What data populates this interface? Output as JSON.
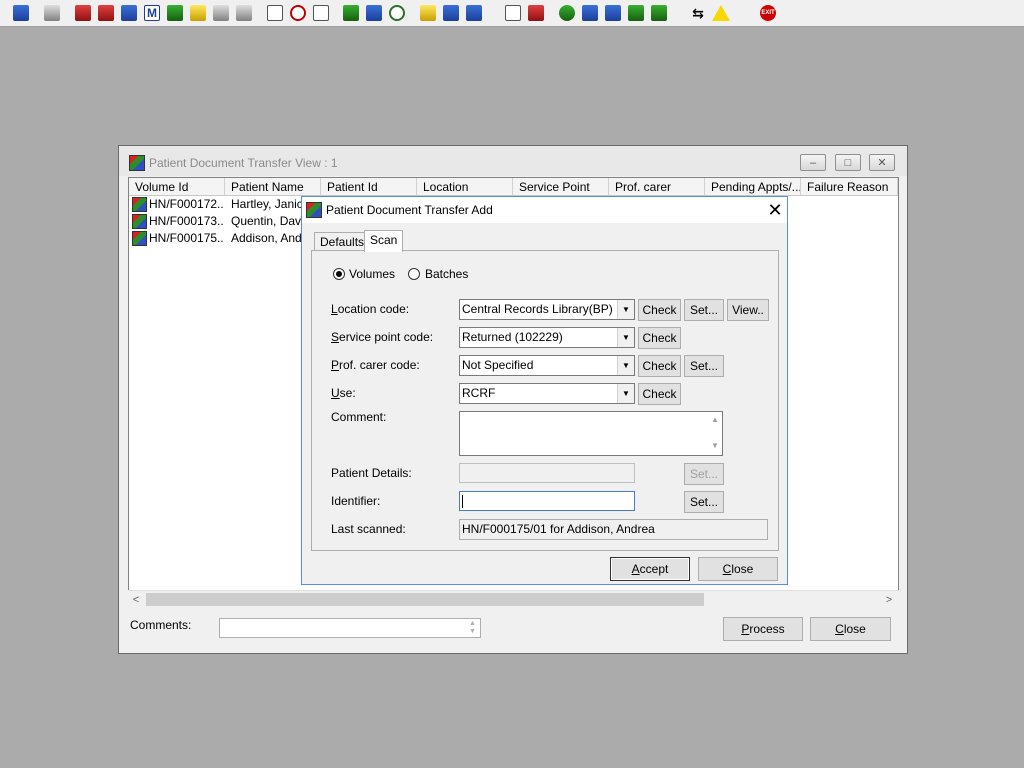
{
  "toolbar": {
    "icons": [
      "user-manage-icon",
      "print-icon",
      "book-red-icon",
      "document-edit-icon",
      "report-icon",
      "m-letter-icon",
      "doctor-icon",
      "notes-icon",
      "ambulance-icon",
      "transfer-icon",
      "mail-icon",
      "clock-icon",
      "window-icon",
      "calendar-icon",
      "form-icon",
      "gauge-icon",
      "notepad-icon",
      "tray-icon",
      "patient-transfer-icon",
      "blank-doc-icon",
      "chart-icon",
      "globe-icon",
      "inbox-down-icon",
      "inbox-check-icon",
      "inbox-green-icon",
      "file-transfer-icon",
      "swap-icon",
      "warning-icon",
      "exit-icon"
    ],
    "exit_label": "EXIT",
    "m_label": "M"
  },
  "main_window": {
    "title": "Patient Document Transfer View : 1",
    "minimize_glyph": "–",
    "restore_glyph": "□",
    "close_glyph": "✕",
    "columns": [
      "Volume Id",
      "Patient Name",
      "Patient Id",
      "Location",
      "Service Point",
      "Prof. carer",
      "Pending Appts/...",
      "Failure Reason"
    ],
    "rows": [
      {
        "volume_id": "HN/F000172...",
        "patient_name": "Hartley, Janice"
      },
      {
        "volume_id": "HN/F000173...",
        "patient_name": "Quentin, David"
      },
      {
        "volume_id": "HN/F000175...",
        "patient_name": "Addison, Andrea"
      }
    ],
    "scroll_left": "<",
    "scroll_right": ">",
    "comments_label": "Comments:",
    "comments_value": "",
    "process_label": "Process",
    "process_accel": "P",
    "close_label": "Close",
    "close_accel": "C"
  },
  "dialog": {
    "title": "Patient Document Transfer Add",
    "close_glyph": "✕",
    "tabs": [
      "Defaults",
      "Scan"
    ],
    "active_tab": "Scan",
    "radio_volumes": "Volumes",
    "radio_batches": "Batches",
    "selected_radio": "Volumes",
    "location_label": "Location code:",
    "location_accel": "L",
    "location_value": "Central Records Library(BP)",
    "service_label": "Service point code:",
    "service_accel": "S",
    "service_value": "Returned (102229)",
    "prof_label": "Prof. carer code:",
    "prof_accel": "P",
    "prof_value": "Not Specified",
    "use_label": "Use:",
    "use_accel": "U",
    "use_value": "RCRF",
    "comment_label": "Comment:",
    "comment_value": "",
    "patient_details_label": "Patient Details:",
    "patient_details_value": "",
    "identifier_label": "Identifier:",
    "identifier_value": "",
    "last_scanned_label": "Last scanned:",
    "last_scanned_value": "HN/F000175/01 for Addison, Andrea",
    "check_label": "Check",
    "set_label": "Set...",
    "view_label": "View..",
    "accept_label": "Accept",
    "close_label": "Close",
    "dropdown_glyph": "▼"
  }
}
